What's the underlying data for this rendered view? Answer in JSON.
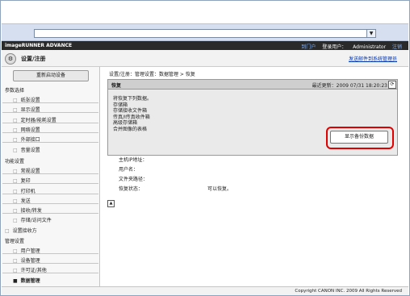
{
  "browser": {
    "address_value": "",
    "go_icon": "dropdown-arrow"
  },
  "banner": {
    "brand": "imageRUNNER ADVANCE",
    "links": [
      "到门户",
      "登录用户："
    ],
    "user": "Administrator",
    "logout": "注销"
  },
  "titlebar": {
    "title": "设置/注册",
    "right_link": "发送邮件到系统管理员"
  },
  "sidebar": {
    "restart_button": "重新启动设备",
    "sections": [
      {
        "label": "参数选择",
        "items": [
          "纸张设置",
          "显示设置",
          "定时器/能耗设置",
          "网络设置",
          "外部接口",
          "音量设置"
        ]
      },
      {
        "label": "功能设置",
        "items": [
          "常规设置",
          "复印",
          "打印机",
          "发送",
          "接收/转发",
          "存储/访问文件"
        ]
      },
      {
        "label": "设置接收方",
        "items": []
      },
      {
        "label": "管理设置",
        "items": [
          "用户管理",
          "设备管理",
          "许可证/其他",
          "数据管理"
        ]
      }
    ]
  },
  "main": {
    "breadcrumb": "设置/注册：管理设置：数据管理 > 恢复",
    "panel": {
      "title": "恢复",
      "updated": "最近更新：2009 07/31 18:20:23",
      "body": [
        "将恢复下列数据。",
        "存储箱",
        "存储接收文件箱",
        "传真/I传真收件箱",
        "高级存储箱",
        "合并图像的表格"
      ],
      "button": "显示备份数据"
    },
    "fields": [
      {
        "label": "主机IP地址：",
        "value": ""
      },
      {
        "label": "用户名：",
        "value": ""
      },
      {
        "label": "文件夹路径：",
        "value": ""
      },
      {
        "label": "恢复状态：",
        "value": "可以恢复。"
      }
    ]
  },
  "footer": {
    "copyright": "Copyright CANON INC. 2009 All Rights Reserved"
  },
  "colors": {
    "highlight": "#e00000",
    "banner": "#2a2a2a",
    "link": "#0033aa"
  }
}
